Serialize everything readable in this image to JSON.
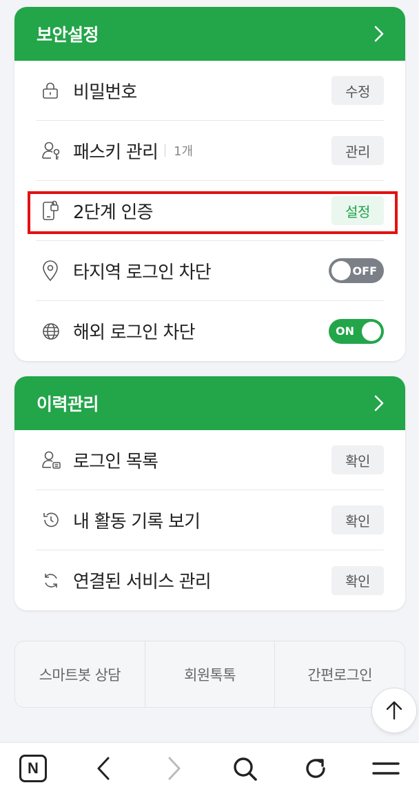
{
  "security": {
    "title": "보안설정",
    "rows": [
      {
        "label": "비밀번호",
        "action": "수정"
      },
      {
        "label": "패스키 관리",
        "sub": "1개",
        "action": "관리"
      },
      {
        "label": "2단계 인증",
        "action": "설정"
      },
      {
        "label": "타지역 로그인 차단",
        "toggle": "OFF"
      },
      {
        "label": "해외 로그인 차단",
        "toggle": "ON"
      }
    ]
  },
  "history": {
    "title": "이력관리",
    "rows": [
      {
        "label": "로그인 목록",
        "action": "확인"
      },
      {
        "label": "내 활동 기록 보기",
        "action": "확인"
      },
      {
        "label": "연결된 서비스 관리",
        "action": "확인"
      }
    ]
  },
  "footer": {
    "links": [
      "스마트봇 상담",
      "회원톡톡",
      "간편로그인"
    ]
  },
  "browser": {
    "logo": "N"
  },
  "colors": {
    "brand_green": "#23a549",
    "highlight_red": "#e41111"
  }
}
